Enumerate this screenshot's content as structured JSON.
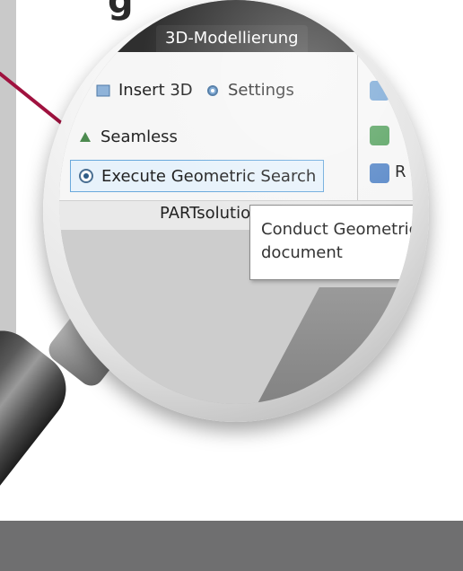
{
  "headline": {
    "fragment": "g"
  },
  "ribbon": {
    "tab_label": "3D-Modellierung",
    "items": {
      "insert3d": "Insert 3D",
      "settings": "Settings",
      "seamless": "Seamless",
      "execute": "Execute Geometric Search"
    },
    "right_partial_letter": "R",
    "group_label": "PARTsolutions"
  },
  "tooltip": {
    "line1": "Conduct Geometric",
    "line2": "document"
  },
  "colors": {
    "accent_line": "#a0123f",
    "selection_border": "#6aa9dc",
    "bottom_band": "#6f6f70"
  },
  "icons": {
    "settings": "gear-icon",
    "seamless": "seamless-icon",
    "execute": "radio-target-icon",
    "insert3d": "insert-3d-icon"
  }
}
